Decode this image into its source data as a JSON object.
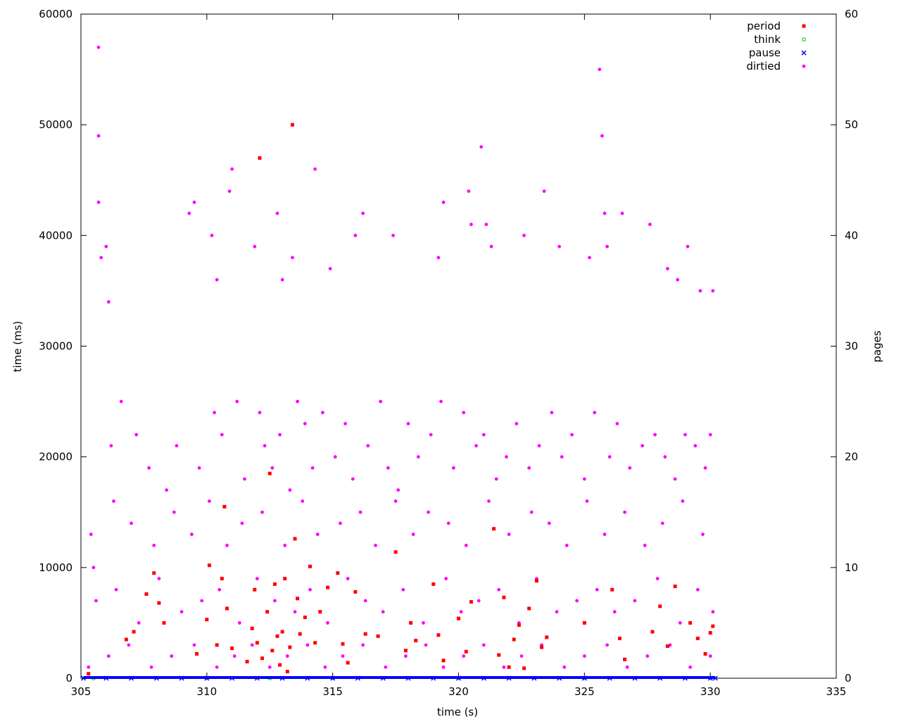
{
  "chart_data": {
    "type": "scatter",
    "xlabel": "time (s)",
    "ylabel": "time (ms)",
    "y2label": "pages",
    "xlim": [
      305,
      335
    ],
    "ylim": [
      0,
      60000
    ],
    "y2lim": [
      0,
      60
    ],
    "x_ticks": [
      "305",
      "310",
      "315",
      "320",
      "325",
      "330",
      "335"
    ],
    "y_ticks": [
      "0",
      "10000",
      "20000",
      "30000",
      "40000",
      "50000",
      "60000"
    ],
    "y2_ticks": [
      "0",
      "10",
      "20",
      "30",
      "40",
      "50",
      "60"
    ],
    "grid": false,
    "legend_placement": "top-right",
    "colors": {
      "period": "#ff0000",
      "think": "#00cc00",
      "pause": "#0000ff",
      "dirtied": "#ff00ff"
    },
    "series": [
      {
        "name": "period",
        "axis": "y",
        "marker": "filled-square",
        "x": [
          305.3,
          306.8,
          307.1,
          307.6,
          307.9,
          308.1,
          308.3,
          309.6,
          310.0,
          310.1,
          310.4,
          310.6,
          310.7,
          310.8,
          311.0,
          311.6,
          311.8,
          311.9,
          312.0,
          312.1,
          312.2,
          312.4,
          312.5,
          312.6,
          312.7,
          312.8,
          312.9,
          313.0,
          313.1,
          313.2,
          313.3,
          313.4,
          313.5,
          313.6,
          313.7,
          313.9,
          314.1,
          314.3,
          314.5,
          314.8,
          315.2,
          315.4,
          315.6,
          315.9,
          316.3,
          316.8,
          317.5,
          317.9,
          318.1,
          318.3,
          319.0,
          319.2,
          319.4,
          320.0,
          320.3,
          320.5,
          321.4,
          321.6,
          321.8,
          322.0,
          322.2,
          322.4,
          322.6,
          322.8,
          323.1,
          323.3,
          323.5,
          325.0,
          326.1,
          326.4,
          326.6,
          327.7,
          328.0,
          328.3,
          328.6,
          329.2,
          329.5,
          329.8,
          330.0,
          330.1
        ],
        "y": [
          400,
          3500,
          4200,
          7600,
          9500,
          6800,
          5000,
          2200,
          5300,
          10200,
          3000,
          9000,
          15500,
          6300,
          2700,
          1500,
          4500,
          8000,
          3200,
          47000,
          1800,
          6000,
          18500,
          2500,
          8500,
          3800,
          1200,
          4200,
          9000,
          600,
          2800,
          50000,
          12600,
          7200,
          4000,
          5500,
          10100,
          3200,
          6000,
          8200,
          9500,
          3100,
          1400,
          7800,
          4000,
          3800,
          11400,
          2500,
          5000,
          3400,
          8500,
          3900,
          1600,
          5400,
          2400,
          6900,
          13500,
          2100,
          7300,
          1000,
          3500,
          4800,
          900,
          6300,
          8800,
          2800,
          3700,
          5000,
          8000,
          3600,
          1700,
          4200,
          6500,
          2900,
          8300,
          5000,
          3600,
          2200,
          4100,
          4700
        ]
      },
      {
        "name": "think",
        "axis": "y",
        "marker": "open-square",
        "x": [
          305.5,
          310.0,
          312.5,
          315.0,
          320.0,
          325.0,
          330.0
        ],
        "y": [
          0,
          0,
          0,
          0,
          0,
          0,
          0
        ]
      },
      {
        "name": "pause",
        "axis": "y",
        "marker": "cross",
        "x": [
          305.1,
          306.0,
          307.0,
          308.0,
          309.0,
          310.0,
          311.0,
          312.0,
          313.0,
          314.0,
          315.0,
          316.0,
          317.0,
          318.0,
          319.0,
          320.0,
          321.0,
          322.0,
          323.0,
          324.0,
          325.0,
          326.0,
          327.0,
          328.0,
          329.0,
          330.0,
          330.2
        ],
        "y": [
          0,
          0,
          0,
          0,
          0,
          0,
          0,
          0,
          0,
          0,
          0,
          0,
          0,
          0,
          0,
          0,
          0,
          0,
          0,
          0,
          0,
          0,
          0,
          0,
          0,
          0,
          0
        ]
      },
      {
        "name": "dirtied",
        "axis": "y2",
        "marker": "dot",
        "x": [
          305.7,
          305.7,
          305.7,
          305.8,
          306.0,
          306.1,
          309.3,
          309.5,
          310.2,
          310.4,
          310.9,
          311.0,
          311.9,
          312.8,
          313.0,
          313.4,
          314.3,
          314.9,
          315.9,
          316.2,
          317.4,
          319.2,
          319.4,
          320.4,
          320.5,
          320.9,
          321.1,
          321.3,
          322.6,
          323.4,
          324.0,
          325.2,
          325.6,
          325.7,
          325.8,
          325.9,
          326.5,
          327.6,
          328.3,
          328.7,
          329.1,
          329.6,
          330.1,
          305.4,
          306.2,
          306.6,
          307.2,
          307.7,
          308.4,
          308.8,
          309.7,
          310.3,
          310.6,
          311.2,
          311.5,
          312.1,
          312.3,
          312.6,
          312.9,
          313.3,
          313.6,
          313.9,
          314.2,
          314.6,
          315.1,
          315.5,
          315.8,
          316.4,
          316.9,
          317.2,
          317.6,
          318.0,
          318.4,
          318.9,
          319.3,
          319.8,
          320.2,
          320.7,
          321.0,
          321.5,
          321.9,
          322.3,
          322.8,
          323.2,
          323.7,
          324.1,
          324.5,
          325.0,
          325.4,
          326.0,
          326.3,
          326.8,
          327.3,
          327.8,
          328.2,
          328.6,
          329.0,
          329.4,
          329.8,
          330.0,
          305.5,
          306.3,
          307.0,
          307.9,
          308.7,
          309.4,
          310.1,
          310.8,
          311.4,
          312.2,
          313.1,
          313.8,
          314.4,
          315.3,
          316.1,
          316.7,
          317.5,
          318.2,
          318.8,
          319.6,
          320.3,
          321.2,
          322.0,
          322.9,
          323.6,
          324.3,
          325.1,
          325.8,
          326.6,
          327.4,
          328.1,
          328.9,
          329.7,
          305.6,
          306.4,
          307.3,
          308.1,
          309.0,
          309.8,
          310.5,
          311.3,
          312.0,
          312.7,
          313.5,
          314.1,
          314.8,
          315.6,
          316.3,
          317.0,
          317.8,
          318.6,
          319.5,
          320.1,
          320.8,
          321.6,
          322.4,
          323.1,
          323.9,
          324.7,
          325.5,
          326.2,
          327.0,
          327.9,
          328.8,
          329.5,
          330.1,
          305.3,
          306.1,
          306.9,
          307.8,
          308.6,
          309.5,
          310.4,
          311.1,
          311.8,
          312.5,
          313.2,
          314.0,
          314.7,
          315.4,
          316.2,
          317.1,
          317.9,
          318.7,
          319.4,
          320.2,
          321.0,
          321.8,
          322.5,
          323.3,
          324.2,
          325.0,
          325.9,
          326.7,
          327.5,
          328.4,
          329.2,
          330.0
        ],
        "y": [
          57,
          49,
          43,
          38,
          39,
          34,
          42,
          43,
          40,
          36,
          44,
          46,
          39,
          42,
          36,
          38,
          46,
          37,
          40,
          42,
          40,
          38,
          43,
          44,
          41,
          48,
          41,
          39,
          40,
          44,
          39,
          38,
          55,
          49,
          42,
          39,
          42,
          41,
          37,
          36,
          39,
          35,
          35,
          13,
          21,
          25,
          22,
          19,
          17,
          21,
          19,
          24,
          22,
          25,
          18,
          24,
          21,
          19,
          22,
          17,
          25,
          23,
          19,
          24,
          20,
          23,
          18,
          21,
          25,
          19,
          17,
          23,
          20,
          22,
          25,
          19,
          24,
          21,
          22,
          18,
          20,
          23,
          19,
          21,
          24,
          20,
          22,
          18,
          24,
          20,
          23,
          19,
          21,
          22,
          20,
          18,
          22,
          21,
          19,
          22,
          10,
          16,
          14,
          12,
          15,
          13,
          16,
          12,
          14,
          15,
          12,
          16,
          13,
          14,
          15,
          12,
          16,
          13,
          15,
          14,
          12,
          16,
          13,
          15,
          14,
          12,
          16,
          13,
          15,
          12,
          14,
          16,
          13,
          7,
          8,
          5,
          9,
          6,
          7,
          8,
          5,
          9,
          7,
          6,
          8,
          5,
          9,
          7,
          6,
          8,
          5,
          9,
          6,
          7,
          8,
          5,
          9,
          6,
          7,
          8,
          6,
          7,
          9,
          5,
          8,
          6,
          1,
          2,
          3,
          1,
          2,
          3,
          1,
          2,
          3,
          1,
          2,
          3,
          1,
          2,
          3,
          1,
          2,
          3,
          1,
          2,
          3,
          1,
          2,
          3,
          1,
          2,
          3,
          1,
          2,
          3,
          1,
          2
        ]
      }
    ]
  }
}
